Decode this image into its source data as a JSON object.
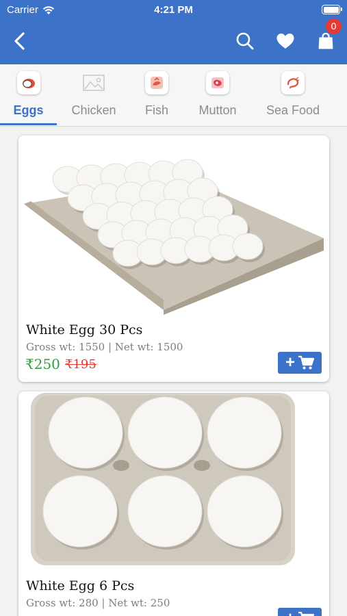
{
  "status_bar": {
    "carrier": "Carrier",
    "time": "4:21 PM"
  },
  "header": {
    "cart_count": "0"
  },
  "categories": [
    {
      "label": "Eggs",
      "icon": "egg-icon",
      "active": true
    },
    {
      "label": "Chicken",
      "icon": "image-placeholder-icon",
      "active": false
    },
    {
      "label": "Fish",
      "icon": "fish-icon",
      "active": false
    },
    {
      "label": "Mutton",
      "icon": "meat-icon",
      "active": false
    },
    {
      "label": "Sea Food",
      "icon": "shrimp-icon",
      "active": false
    }
  ],
  "products": [
    {
      "name": "White Egg 30 Pcs",
      "weight": "Gross wt: 1550 | Net wt: 1500",
      "price": "₹250",
      "mrp": "₹195"
    },
    {
      "name": "White Egg 6 Pcs",
      "weight": "Gross wt: 280 | Net wt: 250",
      "price": "",
      "mrp": ""
    }
  ],
  "colors": {
    "primary": "#3c72c8",
    "price": "#2e9e3e",
    "mrp": "#e53935",
    "badge": "#e53935"
  }
}
